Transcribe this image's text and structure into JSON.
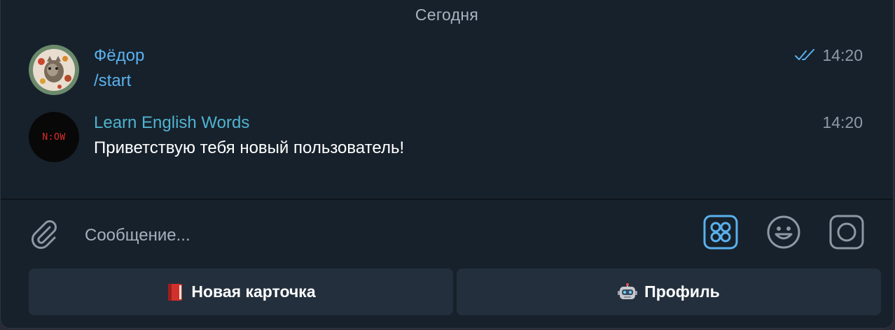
{
  "chat": {
    "date_separator": "Сегодня",
    "messages": [
      {
        "sender": "Фёдор",
        "text": "/start",
        "time": "14:20",
        "status": "read",
        "sender_color": "#5ab1ee",
        "text_color": "#5ab1ee"
      },
      {
        "sender": "Learn English Words",
        "text": "Приветствую тебя новый пользователь!",
        "time": "14:20",
        "avatar_text": "N:OW",
        "sender_color": "#4fb3d0",
        "text_color": "#ffffff"
      }
    ]
  },
  "composer": {
    "placeholder": "Сообщение..."
  },
  "keyboard": {
    "buttons": [
      {
        "label": "Новая карточка",
        "icon": "red-book-emoji"
      },
      {
        "label": "Профиль",
        "icon": "robot-emoji"
      }
    ]
  },
  "colors": {
    "background": "#17212b",
    "accent": "#5ab1ee",
    "button_bg": "#232f3d"
  }
}
